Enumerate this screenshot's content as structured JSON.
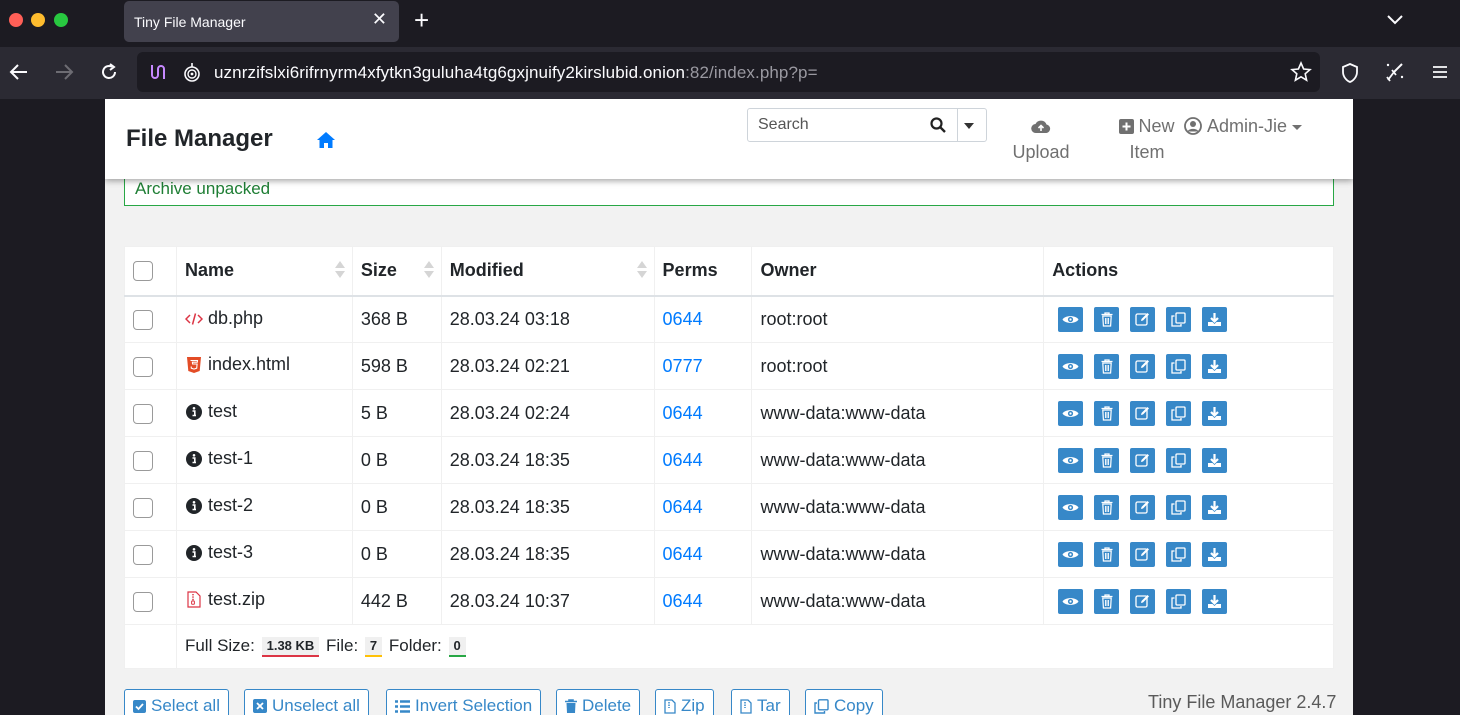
{
  "browser": {
    "tab_title": "Tiny File Manager",
    "url_host": "uznrzifslxi6rifrnyrm4xfytkn3guluha4tg6gxjnuify2kirslubid.onion",
    "url_rest": ":82/index.php?p="
  },
  "app": {
    "brand": "File Manager",
    "search_placeholder": "Search",
    "upload_label": "Upload",
    "new_label_1": "New",
    "new_label_2": "Item",
    "user_label": "Admin-Jie"
  },
  "alert": "Archive unpacked",
  "table": {
    "headers": {
      "name": "Name",
      "size": "Size",
      "modified": "Modified",
      "perms": "Perms",
      "owner": "Owner",
      "actions": "Actions"
    },
    "rows": [
      {
        "name": "db.php",
        "icon": "code-file-icon",
        "size": "368 B",
        "modified": "28.03.24 03:18",
        "perms": "0644",
        "owner": "root:root"
      },
      {
        "name": "index.html",
        "icon": "html5-file-icon",
        "size": "598 B",
        "modified": "28.03.24 02:21",
        "perms": "0777",
        "owner": "root:root"
      },
      {
        "name": "test",
        "icon": "info-circle-icon",
        "size": "5 B",
        "modified": "28.03.24 02:24",
        "perms": "0644",
        "owner": "www-data:www-data"
      },
      {
        "name": "test-1",
        "icon": "info-circle-icon",
        "size": "0 B",
        "modified": "28.03.24 18:35",
        "perms": "0644",
        "owner": "www-data:www-data"
      },
      {
        "name": "test-2",
        "icon": "info-circle-icon",
        "size": "0 B",
        "modified": "28.03.24 18:35",
        "perms": "0644",
        "owner": "www-data:www-data"
      },
      {
        "name": "test-3",
        "icon": "info-circle-icon",
        "size": "0 B",
        "modified": "28.03.24 18:35",
        "perms": "0644",
        "owner": "www-data:www-data"
      },
      {
        "name": "test.zip",
        "icon": "archive-file-icon",
        "size": "442 B",
        "modified": "28.03.24 10:37",
        "perms": "0644",
        "owner": "www-data:www-data"
      }
    ],
    "footer": {
      "full_size_label": "Full Size:",
      "full_size": "1.38 KB",
      "file_label": "File:",
      "file_count": "7",
      "folder_label": "Folder:",
      "folder_count": "0"
    }
  },
  "buttons": {
    "select_all": "Select all",
    "unselect_all": "Unselect all",
    "invert": "Invert Selection",
    "delete": "Delete",
    "zip": "Zip",
    "tar": "Tar",
    "copy": "Copy"
  },
  "version": "Tiny File Manager 2.4.7",
  "colors": {
    "accent": "#3788c8",
    "link": "#007bff",
    "success": "#28a745",
    "browser_bg": "#1c1b22"
  }
}
